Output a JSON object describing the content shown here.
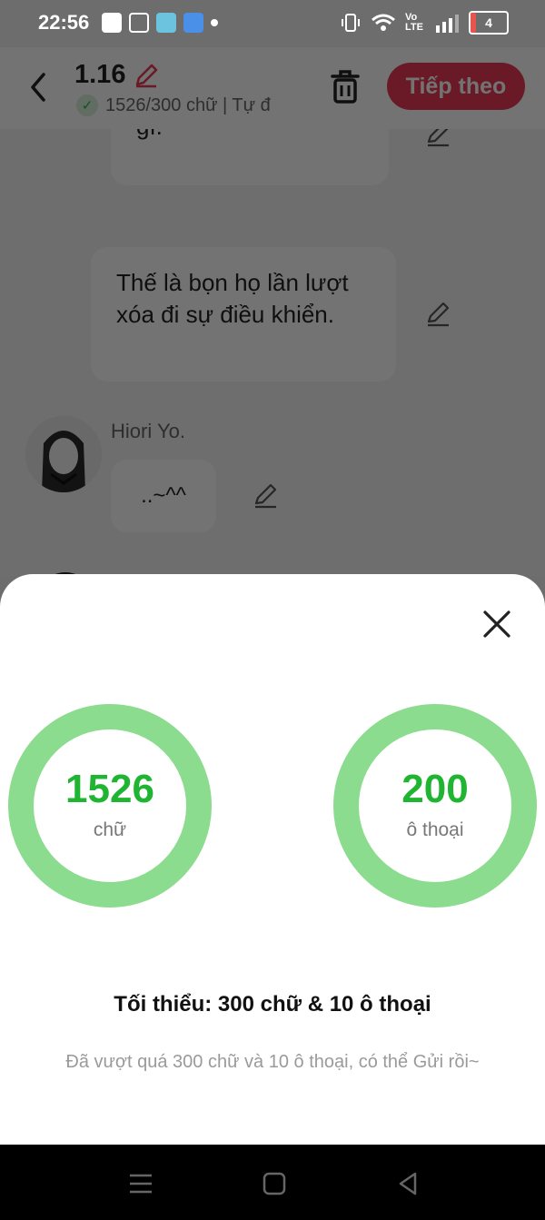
{
  "status": {
    "time": "22:56",
    "network": "Vo LTE",
    "battery": "4",
    "battery_fill": 0.15,
    "app_icons": [
      "facebook-icon",
      "instagram-icon",
      "checklist-app-icon",
      "edit-app-icon",
      "dot-icon"
    ]
  },
  "header": {
    "title": "1.16",
    "meta": "1526/300 chữ | Tự đ",
    "next_label": "Tiếp theo"
  },
  "chat": {
    "bubble1_text": "gì.*",
    "bubble2_text": "Thế là bọn họ lần lượt xóa đi sự điều khiển.",
    "speaker": "Hiori Yo.",
    "bubble3_text": "..~^^"
  },
  "sheet": {
    "words_value": "1526",
    "words_label": "chữ",
    "dialogs_value": "200",
    "dialogs_label": "ô thoại",
    "minimum_title": "Tối thiểu: 300 chữ & 10 ô thoại",
    "note": "Đã vượt quá 300 chữ và 10 ô thoại, có thể Gửi rồi~"
  },
  "colors": {
    "accent_red": "#e83a55",
    "ring_green": "#8bdc8f",
    "value_green": "#1fb532"
  }
}
